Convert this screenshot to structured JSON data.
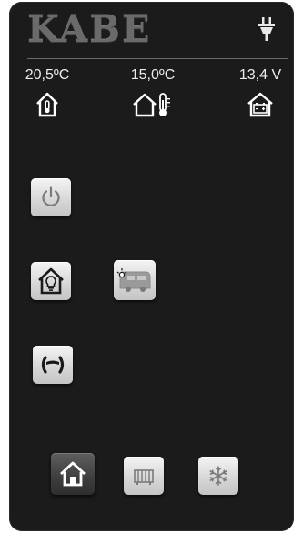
{
  "header": {
    "logo_text": "KABE",
    "power_source_icon": "plug-icon"
  },
  "status": {
    "inside_temp": "20,5ºC",
    "inside_icon": "house-thermometer-icon",
    "outside_temp": "15,0ºC",
    "outside_icon": "outside-thermometer-icon",
    "battery_voltage": "13,4 V",
    "battery_icon": "house-battery-icon"
  },
  "controls": [
    {
      "name": "power",
      "icon": "power-icon"
    },
    {
      "name": "interior-light",
      "icon": "house-lightbulb-icon"
    },
    {
      "name": "exterior-light",
      "icon": "camper-light-icon"
    },
    {
      "name": "leveling",
      "icon": "leveling-icon"
    }
  ],
  "nav": [
    {
      "name": "home",
      "icon": "home-icon",
      "active": true
    },
    {
      "name": "heater",
      "icon": "radiator-icon",
      "active": false
    },
    {
      "name": "cooling",
      "icon": "snowflake-icon",
      "active": false
    }
  ],
  "colors": {
    "background": "#1b1b1b",
    "text": "#ececec",
    "button": "#d8d8d8",
    "button_active": "#3e3e3e"
  }
}
